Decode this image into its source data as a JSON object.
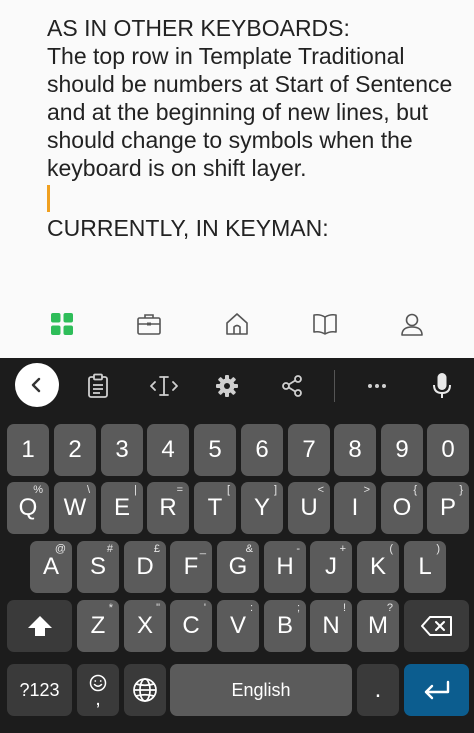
{
  "note": {
    "paragraph1": "AS IN OTHER KEYBOARDS:\nThe top row in Template Traditional should be numbers at Start of Sentence and at the beginning of new lines, but should change to symbols when the keyboard is on shift layer.",
    "paragraph2": "CURRENTLY, IN KEYMAN:"
  },
  "colors": {
    "accent_green": "#2ebd59",
    "caret": "#f0a020",
    "enter_key": "#0c5d8f",
    "key": "#5b5b5b",
    "keyboard_bg": "#1c1c1c"
  },
  "app_nav": {
    "items": [
      "grid-icon",
      "briefcase-icon",
      "home-icon",
      "book-icon",
      "person-icon"
    ]
  },
  "toolbar": {
    "items": [
      "back-icon",
      "clipboard-icon",
      "cursor-icon",
      "gear-icon",
      "share-icon",
      "more-icon",
      "mic-icon"
    ]
  },
  "keys": {
    "row1": [
      {
        "main": "1"
      },
      {
        "main": "2"
      },
      {
        "main": "3"
      },
      {
        "main": "4"
      },
      {
        "main": "5"
      },
      {
        "main": "6"
      },
      {
        "main": "7"
      },
      {
        "main": "8"
      },
      {
        "main": "9"
      },
      {
        "main": "0"
      }
    ],
    "row2": [
      {
        "main": "Q",
        "sub": "%"
      },
      {
        "main": "W",
        "sub": "\\"
      },
      {
        "main": "E",
        "sub": "|"
      },
      {
        "main": "R",
        "sub": "="
      },
      {
        "main": "T",
        "sub": "["
      },
      {
        "main": "Y",
        "sub": "]"
      },
      {
        "main": "U",
        "sub": "<"
      },
      {
        "main": "I",
        "sub": ">"
      },
      {
        "main": "O",
        "sub": "{"
      },
      {
        "main": "P",
        "sub": "}"
      }
    ],
    "row3": [
      {
        "main": "A",
        "sub": "@"
      },
      {
        "main": "S",
        "sub": "#"
      },
      {
        "main": "D",
        "sub": "£"
      },
      {
        "main": "F",
        "sub": "_"
      },
      {
        "main": "G",
        "sub": "&"
      },
      {
        "main": "H",
        "sub": "-"
      },
      {
        "main": "J",
        "sub": "+"
      },
      {
        "main": "K",
        "sub": "("
      },
      {
        "main": "L",
        "sub": ")"
      }
    ],
    "row4": [
      {
        "main": "Z",
        "sub": "*"
      },
      {
        "main": "X",
        "sub": "\""
      },
      {
        "main": "C",
        "sub": "'"
      },
      {
        "main": "V",
        "sub": ":"
      },
      {
        "main": "B",
        "sub": ";"
      },
      {
        "main": "N",
        "sub": "!"
      },
      {
        "main": "M",
        "sub": "?"
      }
    ],
    "row5": {
      "symbols_label": "?123",
      "emoji_sub": ",",
      "space_label": "English",
      "period_label": "."
    }
  }
}
